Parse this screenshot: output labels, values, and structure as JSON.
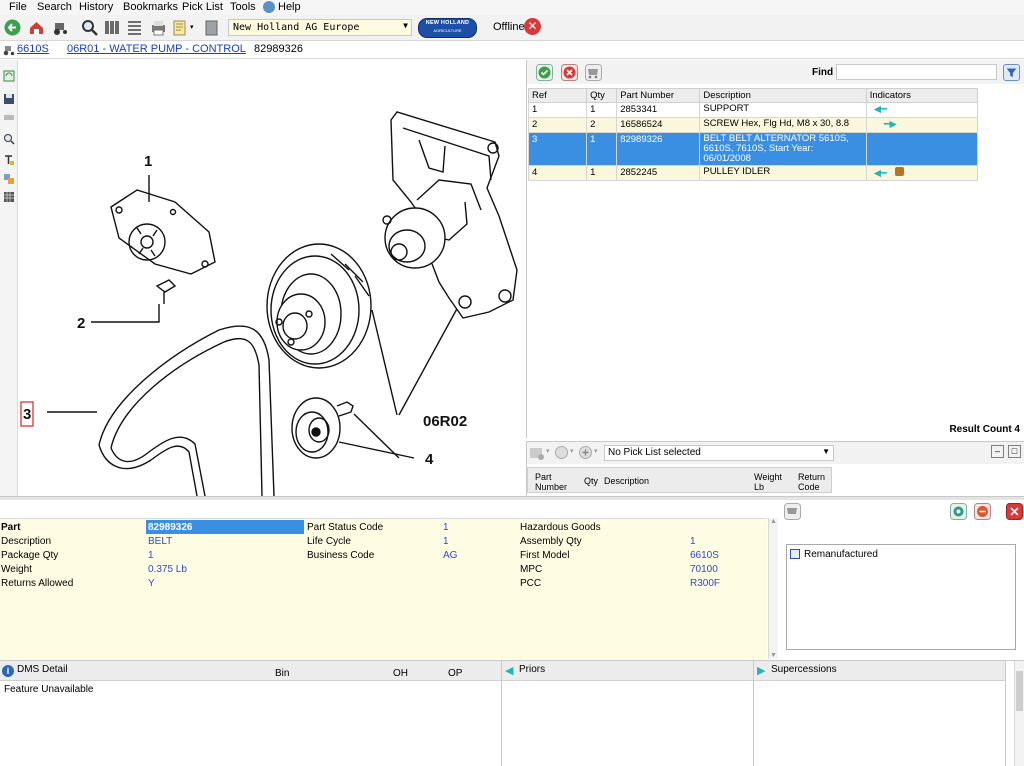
{
  "menu": {
    "items": [
      "File",
      "Search",
      "History",
      "Bookmarks",
      "Pick List",
      "Tools",
      "Help"
    ]
  },
  "toolbar": {
    "region_value": "New Holland AG Europe",
    "brand_logo_text": "NEW HOLLAND",
    "brand_logo_sub": "AGRICULTURE",
    "offline_label": "Offline"
  },
  "breadcrumb": {
    "model": "6610S",
    "section": "06R01 - WATER PUMP - CONTROL",
    "part": "82989326"
  },
  "diagram": {
    "callouts": [
      "1",
      "2",
      "3",
      "4"
    ],
    "reference_label": "06R02"
  },
  "parts": {
    "find_label": "Find",
    "find_value": "",
    "columns": [
      "Ref",
      "Qty",
      "Part Number",
      "Description",
      "Indicators"
    ],
    "rows": [
      {
        "ref": "1",
        "qty": "1",
        "part": "2853341",
        "desc": "SUPPORT",
        "indicators": [
          "prior-arrow"
        ]
      },
      {
        "ref": "2",
        "qty": "2",
        "part": "16586524",
        "desc": "SCREW Hex, Flg Hd, M8 x 30, 8.8",
        "indicators": [
          "supersession-arrow"
        ]
      },
      {
        "ref": "3",
        "qty": "1",
        "part": "82989326",
        "desc": "BELT BELT ALTERNATOR 5610S, 6610S, 7610S, Start Year: 06/01/2008",
        "indicators": []
      },
      {
        "ref": "4",
        "qty": "1",
        "part": "2852245",
        "desc": "PULLEY IDLER",
        "indicators": [
          "prior-arrow",
          "kit-icon"
        ]
      }
    ],
    "result_count": "Result Count 4"
  },
  "picklist": {
    "selected": "No Pick List selected",
    "columns": [
      "Part Number",
      "Qty",
      "Description",
      "Weight Lb",
      "Return Code"
    ]
  },
  "detail": {
    "col1": [
      {
        "label": "Part",
        "value": "82989326"
      },
      {
        "label": "Description",
        "value": "BELT"
      },
      {
        "label": "Package Qty",
        "value": "1"
      },
      {
        "label": "Weight",
        "value": "0.375 Lb"
      },
      {
        "label": "Returns Allowed",
        "value": "Y"
      }
    ],
    "col2": [
      {
        "label": "Part Status Code",
        "value": "1"
      },
      {
        "label": "Life Cycle",
        "value": "1"
      },
      {
        "label": "Business Code",
        "value": "AG"
      }
    ],
    "col3": [
      {
        "label": "Hazardous Goods",
        "value": ""
      },
      {
        "label": "Assembly Qty",
        "value": "1"
      },
      {
        "label": "First Model",
        "value": "6610S"
      },
      {
        "label": "MPC",
        "value": "70100"
      },
      {
        "label": "PCC",
        "value": "R300F"
      }
    ],
    "remanufactured_label": "Remanufactured"
  },
  "dms": {
    "title": "DMS Detail",
    "columns": [
      "Bin",
      "OH",
      "OP"
    ],
    "message": "Feature Unavailable"
  },
  "priors": {
    "title": "Priors"
  },
  "supercessions": {
    "title": "Supercessions"
  },
  "colors": {
    "accent": "#3b8fe3",
    "value_text": "#2a4ad1",
    "link": "#1a3fc4",
    "alt_row": "#fbf7dc",
    "detail_bg": "#fffce4"
  }
}
